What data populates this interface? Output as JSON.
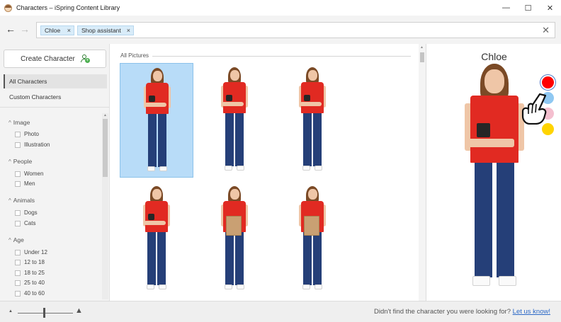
{
  "window": {
    "title": "Characters – iSpring Content Library",
    "controls": {
      "minimize": "—",
      "maximize": "☐",
      "close": "✕"
    }
  },
  "nav": {
    "back": "←",
    "forward": "→"
  },
  "search": {
    "chips": [
      {
        "label": "Chloe",
        "remove": "×"
      },
      {
        "label": "Shop assistant",
        "remove": "×"
      }
    ],
    "clear": "✕"
  },
  "sidebar": {
    "create_button": "Create Character",
    "nav_items": [
      {
        "label": "All Characters",
        "active": true
      },
      {
        "label": "Custom Characters",
        "active": false
      }
    ],
    "filters": [
      {
        "title": "Image",
        "options": [
          "Photo",
          "Illustration"
        ]
      },
      {
        "title": "People",
        "options": [
          "Women",
          "Men"
        ]
      },
      {
        "title": "Animals",
        "options": [
          "Dogs",
          "Cats"
        ]
      },
      {
        "title": "Age",
        "options": [
          "Under 12",
          "12 to 18",
          "18 to 25",
          "25 to 40",
          "40 to 60"
        ]
      }
    ]
  },
  "gallery": {
    "section_title": "All Pictures",
    "cards": [
      {
        "pose": "scanner",
        "selected": true
      },
      {
        "pose": "scanner",
        "selected": false
      },
      {
        "pose": "scanner",
        "selected": false
      },
      {
        "pose": "scanner",
        "selected": false
      },
      {
        "pose": "bag",
        "selected": false
      },
      {
        "pose": "bag",
        "selected": false
      }
    ]
  },
  "preview": {
    "name": "Chloe",
    "swatches": [
      {
        "color": "#ff0000",
        "selected": true
      },
      {
        "color": "#8fc8f2",
        "selected": false
      },
      {
        "color": "#f4bfcf",
        "selected": false
      },
      {
        "color": "#ffd400",
        "selected": false
      }
    ],
    "colors": {
      "shirt": "#e12a22",
      "jeans": "#253f78",
      "hair": "#7b4a26"
    }
  },
  "footer": {
    "text": "Didn't find the character you were looking for?",
    "link": "Let us know!",
    "zoom_small_icon": "▲",
    "zoom_large_icon": "▲"
  }
}
